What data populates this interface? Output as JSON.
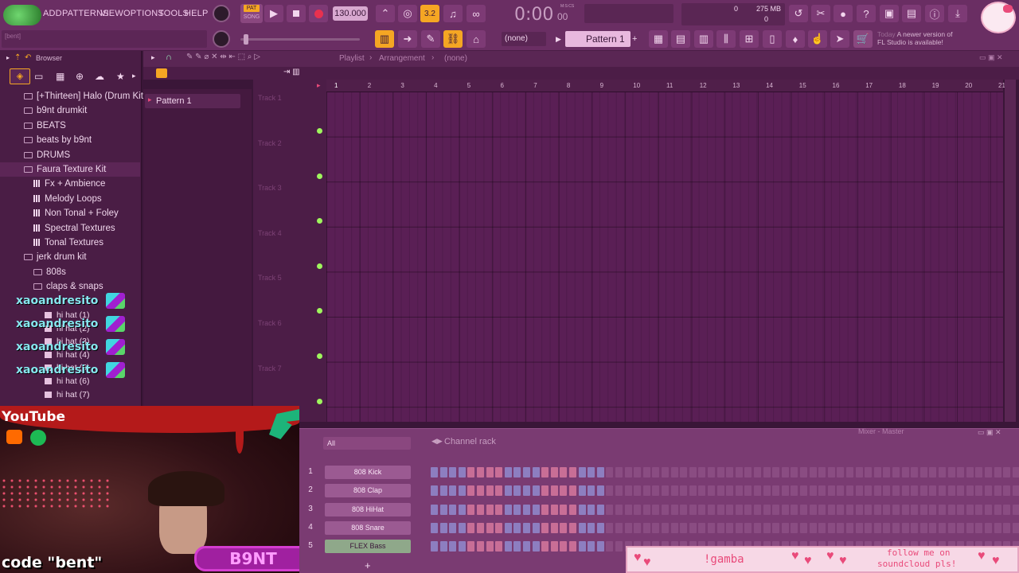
{
  "menu": {
    "items": [
      "ADD",
      "PATTERNS",
      "VIEW",
      "OPTIONS",
      "TOOLS",
      "HELP"
    ]
  },
  "transport": {
    "pat_label": "PAT",
    "song_label": "SONG",
    "tempo": "130.000",
    "time": "0:00",
    "time_frac": "00",
    "time_unit": "M:S:CS",
    "step_label": "3.2"
  },
  "meter": {
    "cpu": "0",
    "ram": "275 MB",
    "poly": "0"
  },
  "hint": {
    "bar": "[bent]"
  },
  "toolbar2": {
    "snap": "(none)",
    "pattern": "Pattern 1"
  },
  "news": {
    "today": "Today",
    "line1": "A newer version of",
    "line2": "FL Studio is available!"
  },
  "browser": {
    "title": "Browser",
    "items": [
      {
        "label": "[+Thirteen] Halo (Drum Kit)",
        "type": "folder",
        "indent": 0
      },
      {
        "label": "b9nt drumkit",
        "type": "folder",
        "indent": 0
      },
      {
        "label": "BEATS",
        "type": "folder",
        "indent": 0
      },
      {
        "label": "beats by b9nt",
        "type": "folder",
        "indent": 0
      },
      {
        "label": "DRUMS",
        "type": "folder",
        "indent": 0
      },
      {
        "label": "Faura Texture Kit",
        "type": "folder",
        "indent": 0,
        "selected": true
      },
      {
        "label": "Fx + Ambience",
        "type": "bars",
        "indent": 1
      },
      {
        "label": "Melody Loops",
        "type": "bars",
        "indent": 1
      },
      {
        "label": "Non Tonal + Foley",
        "type": "bars",
        "indent": 1
      },
      {
        "label": "Spectral Textures",
        "type": "bars",
        "indent": 1
      },
      {
        "label": "Tonal Textures",
        "type": "bars",
        "indent": 1
      },
      {
        "label": "jerk drum kit",
        "type": "folder",
        "indent": 0
      },
      {
        "label": "808s",
        "type": "folder",
        "indent": 1
      },
      {
        "label": "claps & snaps",
        "type": "folder",
        "indent": 1
      }
    ],
    "hihats": [
      "hi hat (1)",
      "hi hat (2)",
      "hi hat (3)",
      "hi hat (4)",
      "hi hat (5)",
      "hi hat (6)",
      "hi hat (7)"
    ]
  },
  "chat": {
    "messages": [
      "xaoandresito",
      "xaoandresito",
      "xaoandresito",
      "xaoandresito"
    ]
  },
  "patterns": {
    "items": [
      "Pattern 1"
    ]
  },
  "playlist": {
    "title": "Playlist",
    "breadcrumb": "Arrangement",
    "selection": "(none)",
    "tracks": [
      "Track 1",
      "Track 2",
      "Track 3",
      "Track 4",
      "Track 5",
      "Track 6",
      "Track 7"
    ],
    "bars": [
      "1",
      "2",
      "3",
      "4",
      "5",
      "6",
      "7",
      "8",
      "9",
      "10",
      "11",
      "12",
      "13",
      "14",
      "15",
      "16",
      "17",
      "18",
      "19",
      "20",
      "21"
    ]
  },
  "channel_rack": {
    "title": "Channel rack",
    "filter": "All",
    "mixer": "Mixer - Master",
    "add": "+",
    "channels": [
      {
        "num": "1",
        "name": "808 Kick"
      },
      {
        "num": "2",
        "name": "808 Clap"
      },
      {
        "num": "3",
        "name": "808 HiHat"
      },
      {
        "num": "4",
        "name": "808 Snare"
      },
      {
        "num": "5",
        "name": "FLEX Bass"
      }
    ]
  },
  "overlay": {
    "youtube": "YouTube",
    "logo": "B9NT",
    "code": "code \"bent\"",
    "donation_name": "!gamba",
    "donation_msg1": "follow me on",
    "donation_msg2": "soundcloud pls!"
  },
  "colors": {
    "bg": "#3a1638",
    "accent": "#f5a623",
    "grid": "#5a1f55",
    "track_dot": "#9ff55e",
    "chat": "#86e6ee"
  }
}
